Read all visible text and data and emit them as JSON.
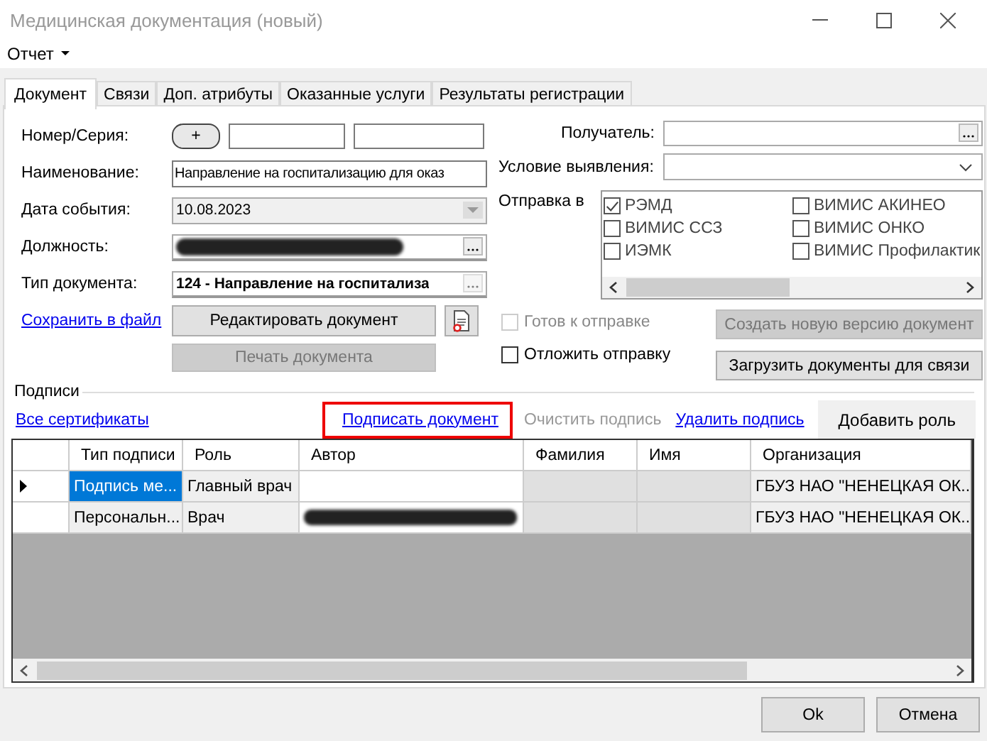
{
  "window": {
    "title": "Медицинская документация (новый)"
  },
  "menu": [
    {
      "label": "Отчет",
      "dropdown": true
    }
  ],
  "tabs": [
    {
      "label": "Документ",
      "selected": true
    },
    {
      "label": "Связи",
      "selected": false
    },
    {
      "label": "Доп. атрибуты",
      "selected": false
    },
    {
      "label": "Оказанные услуги",
      "selected": false
    },
    {
      "label": "Результаты регистрации",
      "selected": false
    }
  ],
  "fields": [
    {
      "kind": "number",
      "label": "Номер/Серия:",
      "button": "+"
    },
    {
      "kind": "text",
      "label": "Наименование:",
      "value": "Направление на госпитализацию для оказ"
    },
    {
      "kind": "date",
      "label": "Дата события:",
      "value": "10.08.2023",
      "disabled": true
    },
    {
      "kind": "lookup",
      "label": "Должность:",
      "redacted": true,
      "disabled": false
    },
    {
      "kind": "lookup",
      "label": "Тип документа:",
      "value": "124 - Направление на госпитализа",
      "bold": true,
      "disabled": true
    }
  ],
  "save_link": "Сохранить в файл",
  "edit_button": "Редактировать документ",
  "print_button": {
    "label": "Печать документа",
    "disabled": true
  },
  "recipient": {
    "label": "Получатель:"
  },
  "condition": {
    "label": "Условие выявления:"
  },
  "send_to": {
    "label": "Отправка в",
    "options": [
      {
        "label": "РЭМД",
        "checked": true
      },
      {
        "label": "ВИМИС ССЗ",
        "checked": false
      },
      {
        "label": "ИЭМК",
        "checked": false
      },
      {
        "label": "ВИМИС АКИНЕО",
        "checked": false
      },
      {
        "label": "ВИМИС ОНКО",
        "checked": false
      },
      {
        "label": "ВИМИС Профилактик",
        "checked": false
      }
    ]
  },
  "ready": {
    "label": "Готов к отправке",
    "checked": false,
    "disabled": true
  },
  "postpone": {
    "label": "Отложить отправку",
    "checked": false,
    "disabled": false
  },
  "new_version_button": {
    "label": "Создать новую версию документ",
    "disabled": true
  },
  "load_button": {
    "label": "Загрузить документы для связи",
    "disabled": false
  },
  "signatures": {
    "title": "Подписи",
    "all_certs_link": "Все сертификаты",
    "actions": [
      {
        "label": "Подписать документ",
        "disabled": false,
        "highlighted": true
      },
      {
        "label": "Очистить подпись",
        "disabled": true,
        "highlighted": false
      },
      {
        "label": "Удалить подпись",
        "disabled": false,
        "highlighted": false
      }
    ],
    "add_role_button": "Добавить роль",
    "columns": [
      "Тип подписи",
      "Роль",
      "Автор",
      "Фамилия",
      "Имя",
      "Организация"
    ],
    "rows": [
      {
        "current": true,
        "selected": true,
        "type": "Подпись ме...",
        "role": "Главный врач",
        "org": "ГБУЗ НАО \"НЕНЕЦКАЯ ОК..."
      },
      {
        "current": false,
        "selected": false,
        "type": "Персональн...",
        "role": "Врач",
        "author_redacted": true,
        "org": "ГБУЗ НАО \"НЕНЕЦКАЯ ОК..."
      }
    ]
  },
  "footer_buttons": [
    "Ok",
    "Отмена"
  ]
}
